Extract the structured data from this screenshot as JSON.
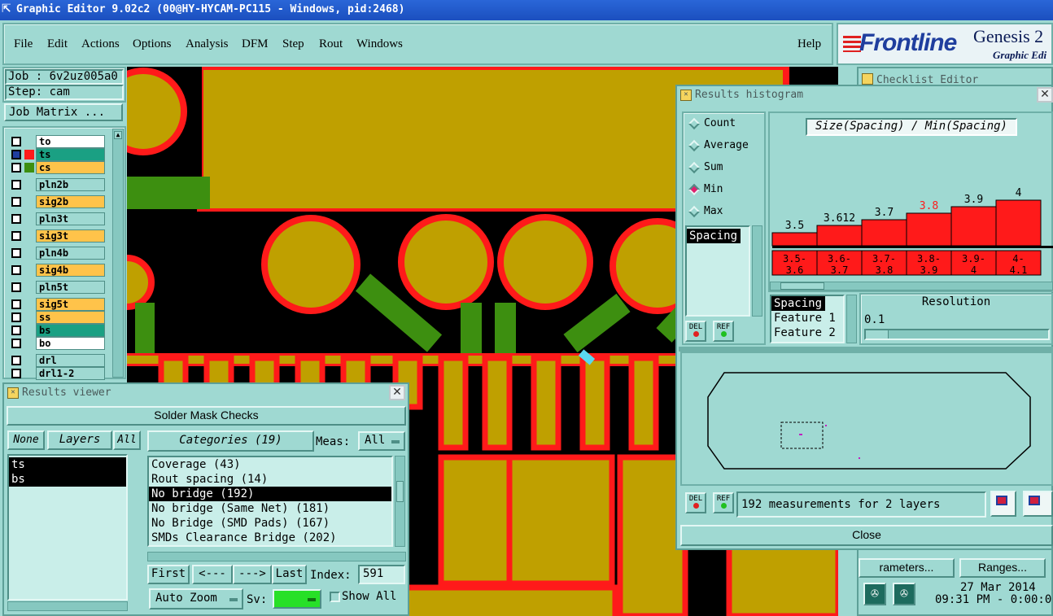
{
  "window": {
    "title": "Graphic Editor 9.02c2 (00@HY-HYCAM-PC115 - Windows, pid:2468)"
  },
  "menu": {
    "items": [
      "File",
      "Edit",
      "Actions",
      "Options",
      "Analysis",
      "DFM",
      "Step",
      "Rout",
      "Windows"
    ],
    "help": "Help"
  },
  "logo": {
    "brand": "Frontline",
    "product": "Genesis 2",
    "subtitle": "Graphic Edi"
  },
  "job": {
    "job_label": "Job : 6v2uz005a0",
    "step_label": "Step: cam",
    "matrix_button": "Job Matrix ..."
  },
  "layers": [
    {
      "name": "to",
      "color": "#ffffff",
      "mark": ""
    },
    {
      "name": "ts",
      "color": "#1aa083",
      "mark": "red"
    },
    {
      "name": "cs",
      "color": "#ffc34a",
      "mark": "green"
    },
    {
      "name": "pln2b",
      "color": "#9fd9d2",
      "mark": ""
    },
    {
      "name": "sig2b",
      "color": "#ffc34a",
      "mark": ""
    },
    {
      "name": "pln3t",
      "color": "#9fd9d2",
      "mark": ""
    },
    {
      "name": "sig3t",
      "color": "#ffc34a",
      "mark": ""
    },
    {
      "name": "pln4b",
      "color": "#9fd9d2",
      "mark": ""
    },
    {
      "name": "sig4b",
      "color": "#ffc34a",
      "mark": ""
    },
    {
      "name": "pln5t",
      "color": "#9fd9d2",
      "mark": ""
    },
    {
      "name": "sig5t",
      "color": "#ffc34a",
      "mark": ""
    },
    {
      "name": "ss",
      "color": "#ffc34a",
      "mark": ""
    },
    {
      "name": "bs",
      "color": "#1aa083",
      "mark": ""
    },
    {
      "name": "bo",
      "color": "#ffffff",
      "mark": ""
    },
    {
      "name": "drl",
      "color": "#9fd9d2",
      "mark": ""
    },
    {
      "name": "drl1-2",
      "color": "#9fd9d2",
      "mark": ""
    }
  ],
  "results_viewer": {
    "title": "Results viewer",
    "header": "Solder Mask Checks",
    "none_btn": "None",
    "layers_btn": "Layers",
    "all_btn": "All",
    "categories_btn": "Categories (19)",
    "meas_label": "Meas:",
    "meas_value": "All",
    "layer_list": [
      "ts",
      "bs"
    ],
    "categories": [
      "Coverage (43)",
      "Rout spacing (14)",
      "No bridge (192)",
      "No bridge (Same Net) (181)",
      "No Bridge (SMD Pads) (167)",
      "SMDs Clearance Bridge (202)"
    ],
    "selected_category": 2,
    "first": "First",
    "prev": "<---",
    "next": "--->",
    "last": "Last",
    "index_label": "Index:",
    "index_value": "591",
    "auto_zoom": "Auto Zoom",
    "sv_label": "Sv:",
    "show_all": "Show All"
  },
  "histogram": {
    "title": "Results histogram",
    "modes": [
      "Count",
      "Average",
      "Sum",
      "Min",
      "Max"
    ],
    "selected_mode": "Min",
    "chart_title": "Size(Spacing) / Min(Spacing)",
    "measure_list": [
      "Spacing"
    ],
    "del": "DEL",
    "ref": "REF",
    "feature_list": [
      "Spacing",
      "Feature 1",
      "Feature 2"
    ],
    "resolution_label": "Resolution",
    "resolution_value": "0.1",
    "status": "192 measurements for 2 layers",
    "close": "Close",
    "highlight_color": "#ff1a1a"
  },
  "chart_data": {
    "type": "bar",
    "categories": [
      "3.5-3.6",
      "3.6-3.7",
      "3.7-3.8",
      "3.8-3.9",
      "3.9-4",
      "4-4.1"
    ],
    "values": [
      3.5,
      3.612,
      3.7,
      3.8,
      3.9,
      4
    ],
    "value_labels": [
      "3.5",
      "3.612",
      "3.7",
      "3.8",
      "3.9",
      "4"
    ],
    "category_labels": [
      [
        "3.5-",
        "3.6"
      ],
      [
        "3.6-",
        "3.7"
      ],
      [
        "3.7-",
        "3.8"
      ],
      [
        "3.8-",
        "3.9"
      ],
      [
        "3.9-",
        "4"
      ],
      [
        "4-",
        "4.1"
      ]
    ],
    "highlighted_index": 3,
    "title": "Size(Spacing) / Min(Spacing)",
    "bar_color": "#ff1a1a"
  },
  "checklist": {
    "title": "Checklist Editor",
    "parameters": "rameters...",
    "ranges": "Ranges...",
    "date": "27 Mar 2014",
    "time": "09:31 PM - 0:00:0"
  }
}
